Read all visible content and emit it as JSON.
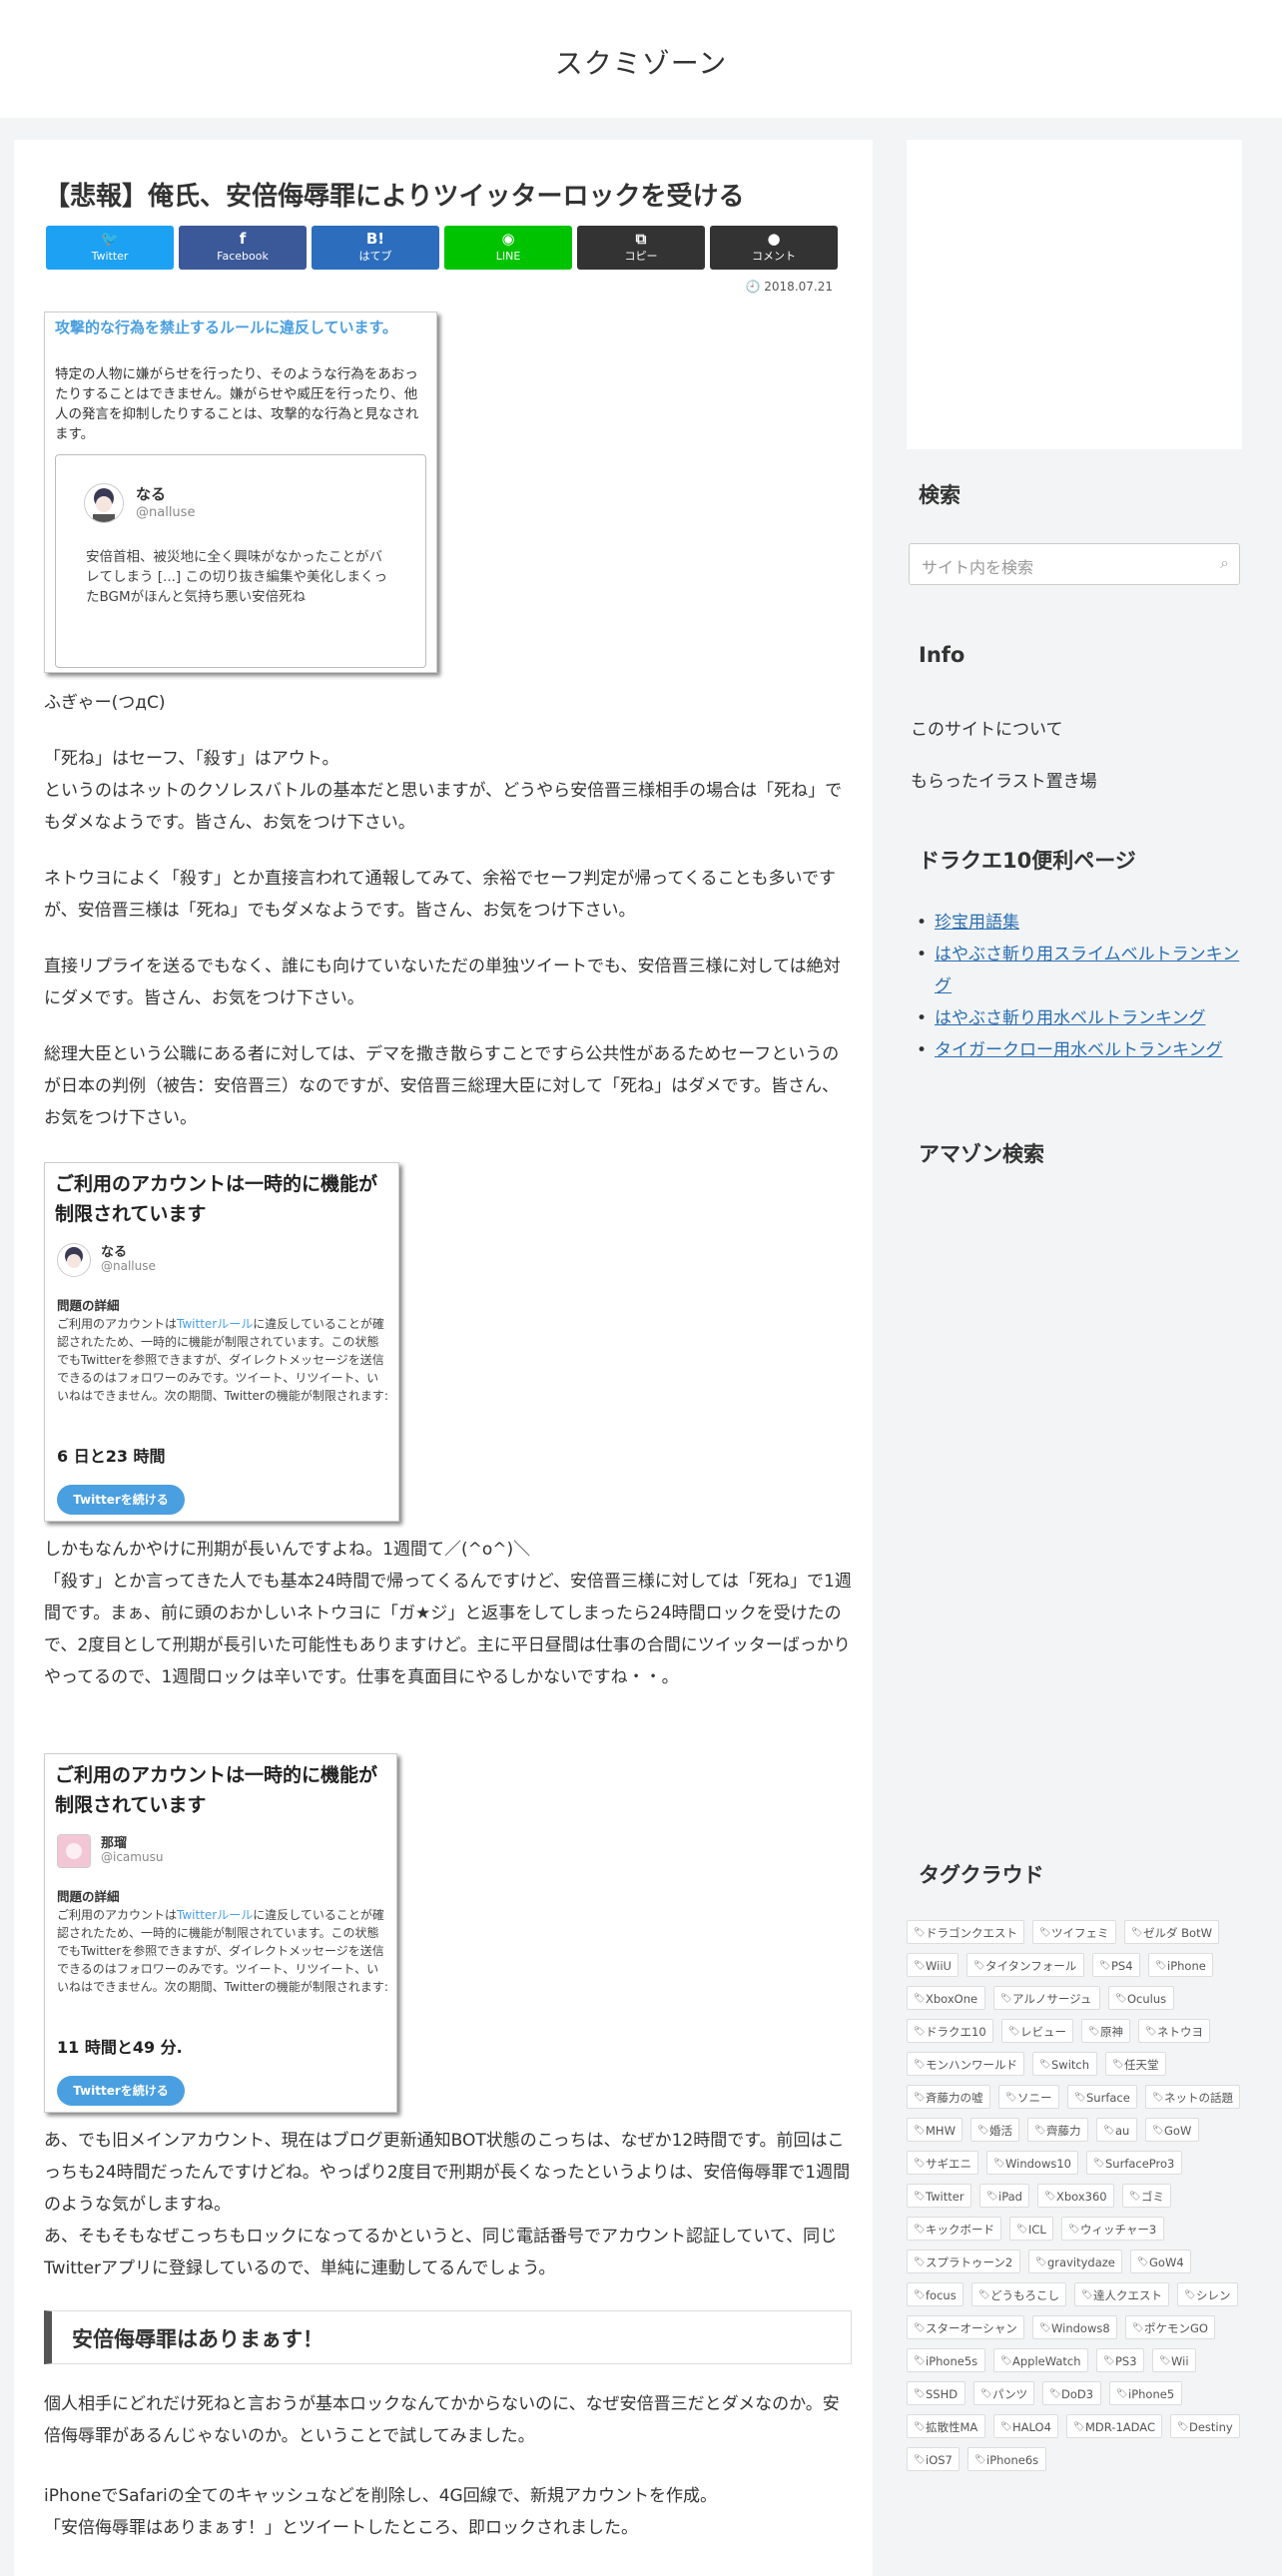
{
  "site": {
    "title": "スクミゾーン"
  },
  "post": {
    "title": "【悲報】俺氏、安倍侮辱罪によりツイッターロックを受ける",
    "date": "2018.07.21",
    "share": [
      {
        "label": "Twitter",
        "icon": "🐦",
        "color": "#1da1f2"
      },
      {
        "label": "Facebook",
        "icon": "f",
        "color": "#3b5998"
      },
      {
        "label": "はてブ",
        "icon": "B!",
        "color": "#2c6ebd"
      },
      {
        "label": "LINE",
        "icon": "◉",
        "color": "#00c300"
      },
      {
        "label": "コピー",
        "icon": "⧉",
        "color": "#333333"
      },
      {
        "label": "コメント",
        "icon": "●",
        "color": "#333333"
      }
    ],
    "image1": {
      "title": "攻撃的な行為を禁止するルールに違反しています。",
      "desc": "特定の人物に嫌がらせを行ったり、そのような行為をあおったりすることはできません。嫌がらせや威圧を行ったり、他人の発言を抑制したりすることは、攻撃的な行為と見なされます。",
      "name": "なる",
      "handle": "@nalluse",
      "tweet": "安倍首相、被災地に全く興味がなかったことがバレてしまう [...] この切り抜き編集や美化しまくったBGMがほんと気持ち悪い安倍死ね"
    },
    "para1": "ふぎゃー(つдC)",
    "para2a": "「死ね」はセーフ、「殺す」はアウト。",
    "para2b": "というのはネットのクソレスバトルの基本だと思いますが、どうやら安倍晋三様相手の場合は「死ね」でもダメなようです。皆さん、お気をつけ下さい。",
    "para3": "ネトウヨによく「殺す」とか直接言われて通報してみて、余裕でセーフ判定が帰ってくることも多いですが、安倍晋三様は「死ね」でもダメなようです。皆さん、お気をつけ下さい。",
    "para4": "直接リプライを送るでもなく、誰にも向けていないただの単独ツイートでも、安倍晋三様に対しては絶対にダメです。皆さん、お気をつけ下さい。",
    "para5": "総理大臣という公職にある者に対しては、デマを撒き散らすことですら公共性があるためセーフというのが日本の判例（被告：安倍晋三）なのですが、安倍晋三総理大臣に対して「死ね」はダメです。皆さん、お気をつけ下さい。",
    "lock": {
      "title": "ご利用のアカウントは一時的に機能が制限されています",
      "detail_heading": "問題の詳細",
      "detail_pre": "ご利用のアカウントは",
      "detail_link": "Twitterルール",
      "detail_post": "に違反していることが確認されたため、一時的に機能が制限されています。この状態でもTwitterを参照できますが、ダイレクトメッセージを送信できるのはフォロワーのみです。ツイート、リツイート、いいねはできません。次の期間、Twitterの機能が制限されます:",
      "button": "Twitterを続ける"
    },
    "image2": {
      "name": "なる",
      "handle": "@nalluse",
      "duration": "6 日と23 時間"
    },
    "para6": "しかもなんかやけに刑期が長いんですよね。1週間て／(^o^)＼",
    "para7": "「殺す」とか言ってきた人でも基本24時間で帰ってくるんですけど、安倍晋三様に対しては「死ね」で1週間です。まぁ、前に頭のおかしいネトウヨに「ガ★ジ」と返事をしてしまったら24時間ロックを受けたので、2度目として刑期が長引いた可能性もありますけど。主に平日昼間は仕事の合間にツイッターばっかりやってるので、1週間ロックは辛いです。仕事を真面目にやるしかないですね・・。",
    "image3": {
      "name": "那瑠",
      "handle": "@icamusu",
      "duration": "11 時間と49 分."
    },
    "para8": "あ、でも旧メインアカウント、現在はブログ更新通知BOT状態のこっちは、なぜか12時間です。前回はこっちも24時間だったんですけどね。やっぱり2度目で刑期が長くなったというよりは、安倍侮辱罪で1週間のような気がしますね。",
    "para9": "あ、そもそもなぜこっちもロックになってるかというと、同じ電話番号でアカウント認証していて、同じTwitterアプリに登録しているので、単純に連動してるんでしょう。",
    "heading2": "安倍侮辱罪はありまぁす！",
    "para10": "個人相手にどれだけ死ねと言おうが基本ロックなんてかからないのに、なぜ安倍晋三だとダメなのか。安倍侮辱罪があるんじゃないのか。ということで試してみました。",
    "para11a": "iPhoneでSafariの全てのキャッシュなどを削除し、4G回線で、新規アカウントを作成。",
    "para11b": "「安倍侮辱罪はありまぁす！」とツイートしたところ、即ロックされました。"
  },
  "sidebar": {
    "search_title": "検索",
    "search_placeholder": "サイト内を検索",
    "info_title": "Info",
    "info_links": [
      "このサイトについて",
      "もらったイラスト置き場"
    ],
    "dq_title": "ドラクエ10便利ページ",
    "dq_links": [
      "珍宝用語集",
      "はやぶさ斬り用スライムベルトランキング",
      "はやぶさ斬り用水ベルトランキング",
      "タイガークロー用水ベルトランキング"
    ],
    "amazon_title": "アマゾン検索",
    "tag_title": "タグクラウド",
    "tags": [
      "ドラゴンクエスト",
      "ツイフェミ",
      "ゼルダ BotW",
      "WiiU",
      "タイタンフォール",
      "PS4",
      "iPhone",
      "XboxOne",
      "アルノサージュ",
      "Oculus",
      "ドラクエ10",
      "レビュー",
      "原神",
      "ネトウヨ",
      "モンハンワールド",
      "Switch",
      "任天堂",
      "斉藤力の嘘",
      "ソニー",
      "Surface",
      "ネットの話題",
      "MHW",
      "婚活",
      "齊藤力",
      "au",
      "GoW",
      "サギエニ",
      "Windows10",
      "SurfacePro3",
      "Twitter",
      "iPad",
      "Xbox360",
      "ゴミ",
      "キックボード",
      "ICL",
      "ウィッチャー3",
      "スプラトゥーン2",
      "gravitydaze",
      "GoW4",
      "focus",
      "どうもろこし",
      "達人クエスト",
      "シレン",
      "スターオーシャン",
      "Windows8",
      "ポケモンGO",
      "iPhone5s",
      "AppleWatch",
      "PS3",
      "Wii",
      "SSHD",
      "パンツ",
      "DoD3",
      "iPhone5",
      "拡散性MA",
      "HALO4",
      "MDR-1ADAC",
      "Destiny",
      "iOS7",
      "iPhone6s"
    ]
  }
}
